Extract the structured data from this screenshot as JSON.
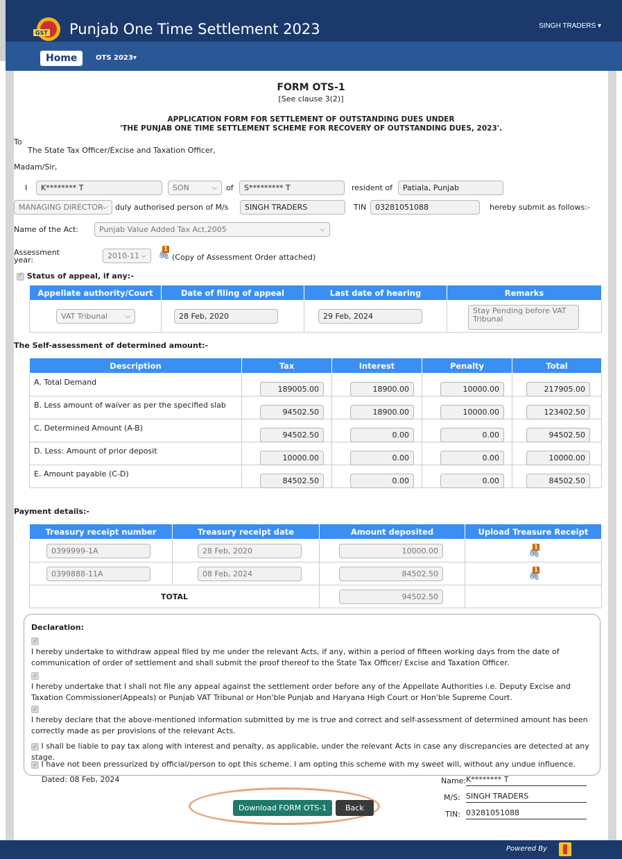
{
  "header": {
    "title": "Punjab One Time Settlement 2023",
    "user": "SINGH TRADERS ▾"
  },
  "nav": {
    "home": "Home",
    "ots": "OTS 2023▾"
  },
  "form": {
    "title": "FORM OTS-1",
    "clause": "[See clause 3(2)]",
    "heading1": "APPLICATION FORM FOR SETTLEMENT OF OUTSTANDING DUES UNDER",
    "heading2": "'THE PUNJAB ONE TIME SETTLEMENT SCHEME FOR RECOVERY OF OUTSTANDING DUES, 2023'.",
    "to": "To",
    "officer": "The State Tax Officer/Excise and Taxation Officer,",
    "salutation": "Madam/Sir,",
    "i_label": "I",
    "name": "K******** T",
    "relation": "SON",
    "of_label": "of",
    "father": "S********* T",
    "resident_label": "resident of",
    "residence": "Patiala, Punjab",
    "designation": "MANAGING DIRECTOR",
    "authorised_label": "duly authorised person of M/s",
    "firm": "SINGH TRADERS",
    "tin_label": "TIN",
    "tin": "03281051088",
    "submit_label": "hereby submit as follows:-",
    "act_label": "Name of the Act:",
    "act": "Punjab Value Added Tax Act,2005",
    "assessment_label1": "Assessment",
    "assessment_label2": "year:",
    "assessment_year": "2010-11",
    "attachment_count": "1",
    "assessment_note": "(Copy of Assessment Order attached)",
    "appeal_status_label": "Status of appeal, if any:-"
  },
  "appeal_table": {
    "headers": [
      "Appellate authority/Court",
      "Date of filing of appeal",
      "Last date of hearing",
      "Remarks"
    ],
    "authority": "VAT Tribunal",
    "filing_date": "28 Feb, 2020",
    "hearing_date": "29 Feb, 2024",
    "remarks": "Stay Pending before VAT Tribunal"
  },
  "self_assessment": {
    "label": "The Self-assessment of determined amount:-",
    "headers": [
      "Description",
      "Tax",
      "Interest",
      "Penalty",
      "Total"
    ],
    "rows": [
      {
        "desc": "A. Total Demand",
        "tax": "189005.00",
        "interest": "18900.00",
        "penalty": "10000.00",
        "total": "217905.00"
      },
      {
        "desc": "B. Less amount of waiver as per the specified slab",
        "tax": "94502.50",
        "interest": "18900.00",
        "penalty": "10000.00",
        "total": "123402.50"
      },
      {
        "desc": "C. Determined Amount (A-B)",
        "tax": "94502.50",
        "interest": "0.00",
        "penalty": "0.00",
        "total": "94502.50"
      },
      {
        "desc": "D. Less: Amount of prior deposit",
        "tax": "10000.00",
        "interest": "0.00",
        "penalty": "0.00",
        "total": "10000.00"
      },
      {
        "desc": "E. Amount payable (C-D)",
        "tax": "84502.50",
        "interest": "0.00",
        "penalty": "0.00",
        "total": "84502.50"
      }
    ]
  },
  "payment": {
    "label": "Payment details:-",
    "headers": [
      "Treasury receipt number",
      "Treasury receipt date",
      "Amount deposited",
      "Upload Treasure Receipt"
    ],
    "rows": [
      {
        "number": "0399999-1A",
        "date": "28 Feb, 2020",
        "amount": "10000.00",
        "count": "1"
      },
      {
        "number": "0399888-11A",
        "date": "08 Feb, 2024",
        "amount": "84502.50",
        "count": "1"
      }
    ],
    "total_label": "TOTAL",
    "total": "94502.50"
  },
  "declaration": {
    "title": "Declaration:",
    "items": [
      "I hereby undertake to withdraw appeal filed by me under the relevant Acts, if any, within a period of fifteen working days from the date of communication of order of settlement and shall submit the proof thereof to the State Tax Officer/ Excise and Taxation Officer.",
      "I hereby undertake that I shall not file any appeal against the settlement order before any of the Appellate Authorities i.e. Deputy Excise and Taxation Commissioner(Appeals) or Punjab VAT Tribunal or Hon'ble Punjab and Haryana High Court or Hon'ble Supreme Court.",
      "I hereby declare that the above-mentioned information submitted by me is true and correct and self-assessment of determined amount has been correctly made as per provisions of the relevant Acts.",
      "I shall be liable to pay tax along with interest and penalty, as applicable, under the relevant Acts in case any discrepancies are detected at any stage.",
      "I have not been pressurized by official/person to opt this scheme. I am opting this scheme with my sweet will, without any undue influence."
    ]
  },
  "signature": {
    "dated": "Dated: 08 Feb, 2024",
    "name_label": "Name:",
    "name": "K******** T",
    "ms_label": "M/S:",
    "ms": "SINGH TRADERS",
    "tin_label": "TIN:",
    "tin": "03281051088"
  },
  "buttons": {
    "download": "Download FORM OTS-1",
    "back": "Back"
  },
  "footer": {
    "powered": "Powered By"
  }
}
